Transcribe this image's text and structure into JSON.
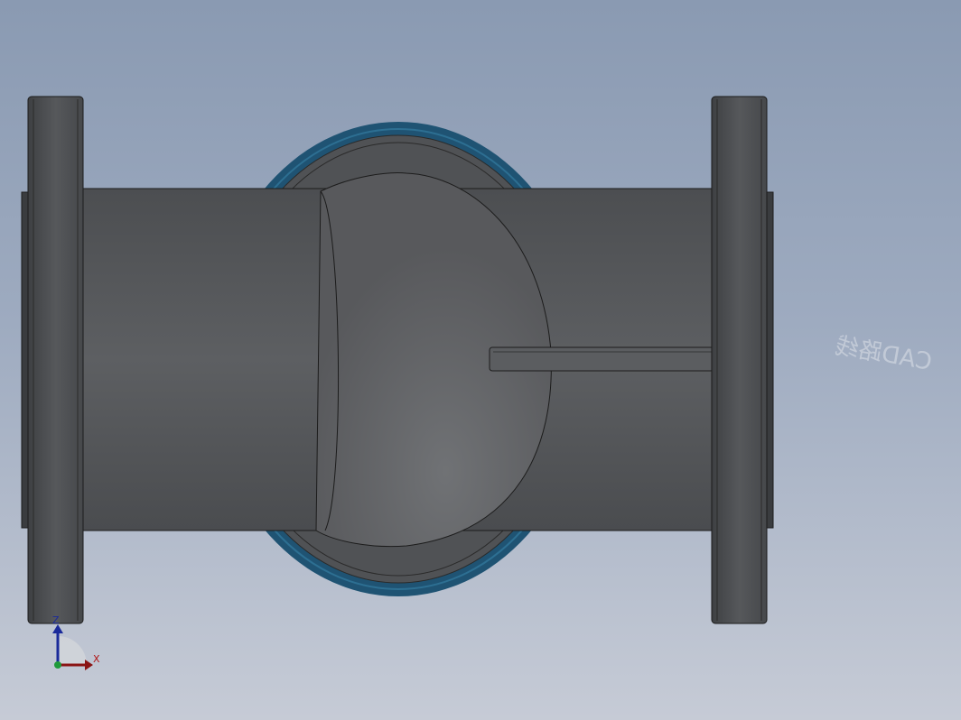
{
  "viewport": {
    "background_top": "#8a9ab2",
    "background_bottom": "#c6cbd6"
  },
  "model": {
    "body_color": "#5a5c5f",
    "seal_ring_color": "#1f5373",
    "edge_color": "#1c1c1c"
  },
  "triad": {
    "z_label": "Z",
    "x_label": "X",
    "z_color": "#1a2a9a",
    "x_color": "#b01818"
  },
  "watermark": {
    "text": "CAD路线",
    "mirrored": true
  }
}
